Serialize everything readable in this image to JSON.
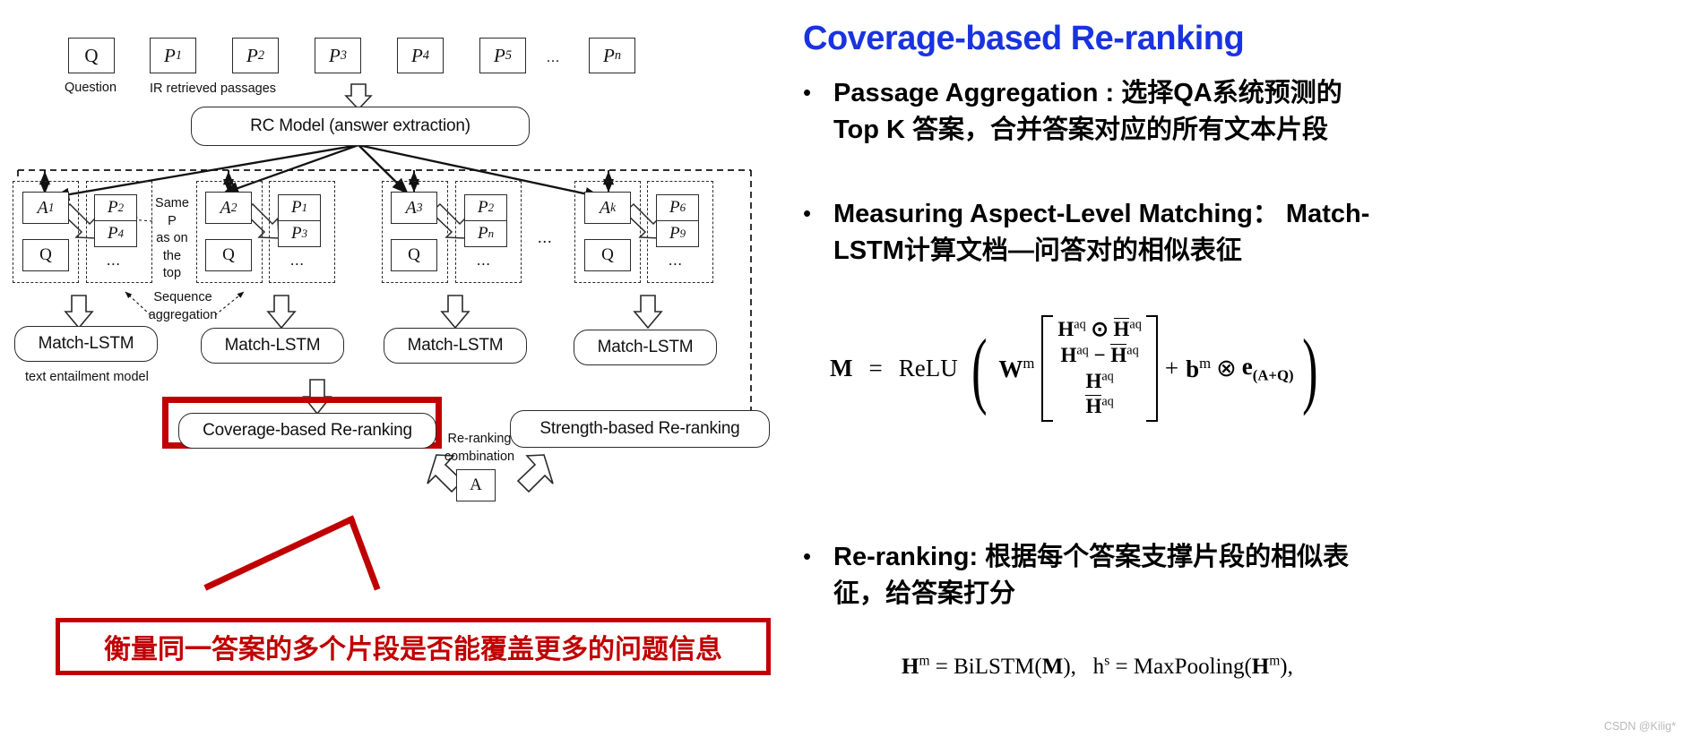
{
  "diagram": {
    "top_row": {
      "question_box": "Q",
      "question_label": "Question",
      "passages": [
        "P",
        "P",
        "P",
        "P",
        "P"
      ],
      "passage_subs": [
        "1",
        "2",
        "3",
        "4",
        "5"
      ],
      "passage_last": "P",
      "passage_last_sub": "n",
      "dots": "...",
      "passages_label": "IR retrieved passages"
    },
    "rc_model": "RC Model (answer extraction)",
    "groups": [
      {
        "answer": "A",
        "answer_sub": "1",
        "q": "Q",
        "passages": [
          "P",
          "P"
        ],
        "passage_subs": [
          "2",
          "4"
        ],
        "dots": "..."
      },
      {
        "answer": "A",
        "answer_sub": "2",
        "q": "Q",
        "passages": [
          "P",
          "P"
        ],
        "passage_subs": [
          "1",
          "3"
        ],
        "dots": "..."
      },
      {
        "answer": "A",
        "answer_sub": "3",
        "q": "Q",
        "passages": [
          "P",
          "P"
        ],
        "passage_subs": [
          "2",
          "n"
        ],
        "dots": "..."
      },
      {
        "answer": "A",
        "answer_sub": "k",
        "q": "Q",
        "passages": [
          "P",
          "P"
        ],
        "passage_subs": [
          "6",
          "9"
        ],
        "dots": "..."
      }
    ],
    "group_gap_dots": "...",
    "same_p_note": [
      "Same",
      "P",
      "as on",
      "the",
      "top"
    ],
    "sequence_aggregation": [
      "Sequence",
      "aggregation"
    ],
    "match_lstm": [
      "Match-LSTM",
      "Match-LSTM",
      "Match-LSTM",
      "Match-LSTM"
    ],
    "text_entailment_label": "text entailment model",
    "coverage_box": "Coverage-based Re-ranking",
    "strength_box": "Strength-based Re-ranking",
    "reranking_combination": [
      "Re-ranking",
      "combination"
    ],
    "answer_box": "A",
    "callout_text": "衡量同一答案的多个片段是否能覆盖更多的问题信息",
    "colors": {
      "highlight_red": "#c00000",
      "line": "#2b2b2b"
    }
  },
  "panel": {
    "title": "Coverage-based Re-ranking",
    "title_color": "#1a33e0",
    "bullets": [
      {
        "marker": "•",
        "text": "Passage Aggregation : 选择QA系统预测的 Top K 答案，合并答案对应的所有文本片段"
      },
      {
        "marker": "•",
        "text": "Measuring Aspect-Level Matching： Match-LSTM计算文档—问答对的相似表征"
      },
      {
        "marker": "•",
        "text": "Re-ranking: 根据每个答案支撑片段的相似表征，给答案打分"
      }
    ],
    "formula_m": {
      "lhs": "M",
      "eq": "=",
      "relu": "ReLU",
      "w": "W",
      "w_sup": "m",
      "rows": [
        "Haq ⊙ H̄aq",
        "Haq − H̄aq",
        "Haq",
        "H̄aq"
      ],
      "plus": "+",
      "b": "b",
      "b_sup": "m",
      "otimes": "⊗",
      "e": "e",
      "e_sub": "(A+Q)"
    },
    "formula_h": "Hm = BiLSTM(M),   hs = MaxPooling(Hm),",
    "watermark": "CSDN @Kilig*"
  }
}
